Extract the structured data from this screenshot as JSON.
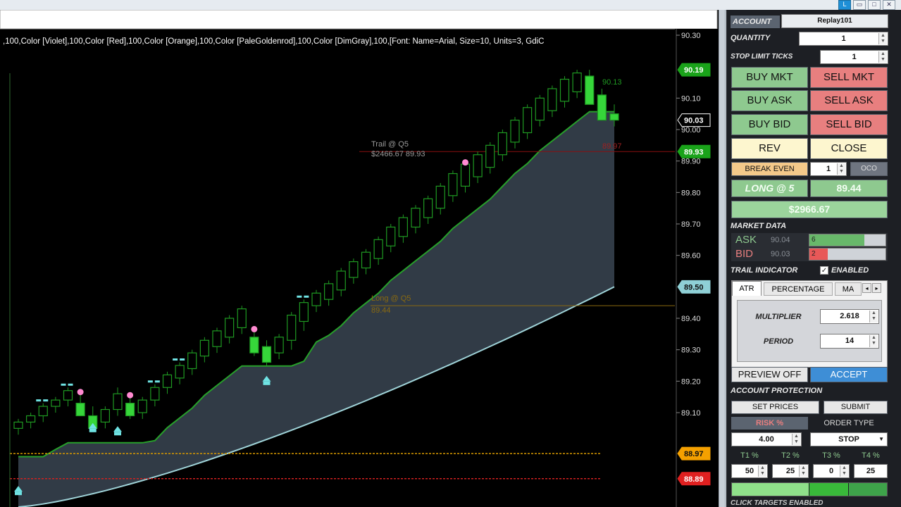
{
  "window": {
    "buttons": [
      "L",
      "▭",
      "□",
      "✕"
    ]
  },
  "chart": {
    "header_text": ",100,Color [Violet],100,Color [Red],100,Color [Orange],100,Color [PaleGoldenrod],100,Color [DimGray],100,[Font: Name=Arial, Size=10, Units=3, GdiC",
    "price_axis": {
      "min": 88.8,
      "max": 90.3,
      "ticks": [
        "90.30",
        "90.10",
        "90.00",
        "89.90",
        "89.80",
        "89.70",
        "89.60",
        "89.40",
        "89.30",
        "89.20",
        "89.10"
      ]
    },
    "price_markers": [
      {
        "label": "90.19",
        "value": 90.19,
        "color": "#1aa31a"
      },
      {
        "label": "90.03",
        "value": 90.03,
        "color": "#ffffff"
      },
      {
        "label": "89.93",
        "value": 89.93,
        "color": "#1aa31a"
      },
      {
        "label": "89.50",
        "value": 89.5,
        "color": "#8fd0d6"
      },
      {
        "label": "88.97",
        "value": 88.97,
        "color": "#f4a000"
      },
      {
        "label": "88.89",
        "value": 88.89,
        "color": "#e02020"
      }
    ],
    "annotations": [
      {
        "lines": [
          "Trail @ Q5",
          "$2466.67 89.93"
        ]
      },
      {
        "lines": [
          "Long @ Q5",
          "89.44"
        ]
      },
      {
        "lines": [
          "90.13"
        ]
      },
      {
        "lines": [
          "89.97"
        ]
      }
    ],
    "candles": [
      [
        89.05,
        89.08,
        89.03,
        89.07,
        0
      ],
      [
        89.07,
        89.1,
        89.05,
        89.09,
        0
      ],
      [
        89.09,
        89.13,
        89.07,
        89.12,
        0
      ],
      [
        89.12,
        89.15,
        89.1,
        89.14,
        0
      ],
      [
        89.14,
        89.18,
        89.12,
        89.17,
        0
      ],
      [
        89.13,
        89.17,
        89.11,
        89.09,
        1
      ],
      [
        89.09,
        89.12,
        89.04,
        89.05,
        1
      ],
      [
        89.07,
        89.12,
        89.05,
        89.11,
        0
      ],
      [
        89.11,
        89.18,
        89.09,
        89.16,
        0
      ],
      [
        89.13,
        89.16,
        89.08,
        89.09,
        1
      ],
      [
        89.1,
        89.15,
        89.08,
        89.14,
        0
      ],
      [
        89.14,
        89.19,
        89.12,
        89.18,
        0
      ],
      [
        89.18,
        89.23,
        89.16,
        89.22,
        0
      ],
      [
        89.21,
        89.26,
        89.19,
        89.25,
        0
      ],
      [
        89.24,
        89.3,
        89.22,
        89.29,
        0
      ],
      [
        89.28,
        89.34,
        89.26,
        89.33,
        0
      ],
      [
        89.31,
        89.37,
        89.29,
        89.36,
        0
      ],
      [
        89.34,
        89.41,
        89.32,
        89.4,
        0
      ],
      [
        89.37,
        89.44,
        89.35,
        89.43,
        0
      ],
      [
        89.34,
        89.37,
        89.28,
        89.29,
        1
      ],
      [
        89.31,
        89.33,
        89.25,
        89.26,
        1
      ],
      [
        89.29,
        89.35,
        89.27,
        89.34,
        0
      ],
      [
        89.33,
        89.42,
        89.3,
        89.41,
        0
      ],
      [
        89.39,
        89.46,
        89.36,
        89.45,
        0
      ],
      [
        89.44,
        89.49,
        89.42,
        89.48,
        0
      ],
      [
        89.46,
        89.52,
        89.44,
        89.51,
        0
      ],
      [
        89.49,
        89.56,
        89.47,
        89.55,
        0
      ],
      [
        89.53,
        89.59,
        89.51,
        89.58,
        0
      ],
      [
        89.56,
        89.62,
        89.54,
        89.61,
        0
      ],
      [
        89.59,
        89.66,
        89.57,
        89.65,
        0
      ],
      [
        89.63,
        89.7,
        89.61,
        89.69,
        0
      ],
      [
        89.66,
        89.73,
        89.64,
        89.72,
        0
      ],
      [
        89.69,
        89.76,
        89.67,
        89.75,
        0
      ],
      [
        89.72,
        89.79,
        89.7,
        89.78,
        0
      ],
      [
        89.75,
        89.83,
        89.73,
        89.82,
        0
      ],
      [
        89.79,
        89.87,
        89.77,
        89.86,
        0
      ],
      [
        89.82,
        89.9,
        89.8,
        89.89,
        0
      ],
      [
        89.85,
        89.93,
        89.83,
        89.92,
        0
      ],
      [
        89.88,
        89.96,
        89.86,
        89.95,
        0
      ],
      [
        89.92,
        90.0,
        89.9,
        89.99,
        0
      ],
      [
        89.96,
        90.04,
        89.94,
        90.03,
        0
      ],
      [
        89.99,
        90.08,
        89.97,
        90.07,
        0
      ],
      [
        90.03,
        90.11,
        90.01,
        90.1,
        0
      ],
      [
        90.06,
        90.14,
        90.04,
        90.13,
        0
      ],
      [
        90.09,
        90.17,
        90.07,
        90.16,
        0
      ],
      [
        90.12,
        90.19,
        90.1,
        90.18,
        0
      ],
      [
        90.17,
        90.19,
        90.13,
        90.08,
        1
      ],
      [
        90.11,
        90.13,
        90.03,
        90.03,
        1
      ],
      [
        90.05,
        90.08,
        90.01,
        90.03,
        1
      ]
    ]
  },
  "panel": {
    "account": {
      "label": "ACCOUNT",
      "value": "Replay101"
    },
    "quantity": {
      "label": "QUANTITY",
      "value": "1"
    },
    "stop_limit": {
      "label": "STOP LIMIT TICKS",
      "value": "1"
    },
    "buy_mkt": "BUY MKT",
    "sell_mkt": "SELL MKT",
    "buy_ask": "BUY ASK",
    "sell_ask": "SELL ASK",
    "buy_bid": "BUY BID",
    "sell_bid": "SELL BID",
    "rev": "REV",
    "close": "CLOSE",
    "break_even": "BREAK EVEN",
    "break_even_value": "1",
    "oco": "OCO",
    "position": "LONG @ 5",
    "position_price": "89.44",
    "pnl": "$2966.67",
    "market_data": "MARKET DATA",
    "ask": {
      "label": "ASK",
      "price": "90.04",
      "size": "6",
      "fill": 0.72
    },
    "bid": {
      "label": "BID",
      "price": "90.03",
      "size": "2",
      "fill": 0.24
    },
    "trail": {
      "label": "TRAIL INDICATOR",
      "enabled": "ENABLED"
    },
    "tabs": [
      "ATR",
      "PERCENTAGE",
      "MA"
    ],
    "multiplier": {
      "label": "MULTIPLIER",
      "value": "2.618"
    },
    "period": {
      "label": "PERIOD",
      "value": "14"
    },
    "preview_off": "PREVIEW OFF",
    "accept": "ACCEPT",
    "account_protection": "ACCOUNT PROTECTION",
    "set_prices": "SET PRICES",
    "submit": "SUBMIT",
    "risk": {
      "label": "RISK %",
      "value": "4.00"
    },
    "order_type": {
      "label": "ORDER TYPE",
      "value": "STOP"
    },
    "targets": [
      {
        "label": "T1 %",
        "value": "50"
      },
      {
        "label": "T2 %",
        "value": "25"
      },
      {
        "label": "T3 %",
        "value": "0"
      },
      {
        "label": "T4 %",
        "value": "25"
      }
    ],
    "footer": "CLICK TARGETS ENABLED",
    "colors": {
      "green": "#8ec98f",
      "red": "#e87f7f",
      "cream": "#fdf6cf",
      "blue": "#3e8ed6"
    }
  }
}
